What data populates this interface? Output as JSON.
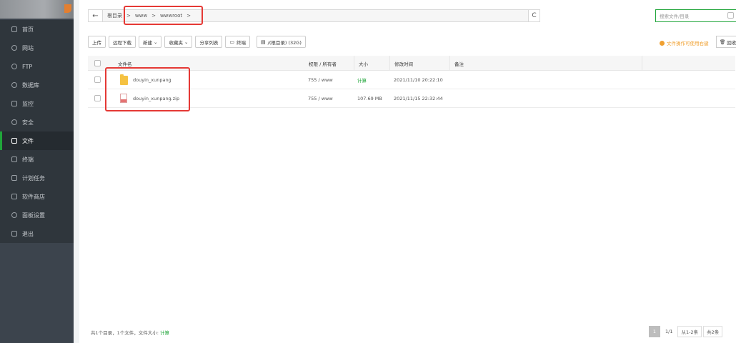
{
  "sidebar": {
    "items": [
      {
        "label": "首页",
        "icon": "home-icon",
        "active": false
      },
      {
        "label": "网站",
        "icon": "globe-icon",
        "active": false
      },
      {
        "label": "FTP",
        "icon": "ftp-icon",
        "active": false
      },
      {
        "label": "数据库",
        "icon": "database-icon",
        "active": false
      },
      {
        "label": "监控",
        "icon": "monitor-icon",
        "active": false
      },
      {
        "label": "安全",
        "icon": "shield-icon",
        "active": false
      },
      {
        "label": "文件",
        "icon": "folder-icon",
        "active": true
      },
      {
        "label": "终端",
        "icon": "terminal-icon",
        "active": false
      },
      {
        "label": "计划任务",
        "icon": "calendar-icon",
        "active": false
      },
      {
        "label": "软件商店",
        "icon": "apps-icon",
        "active": false
      },
      {
        "label": "面板设置",
        "icon": "gear-icon",
        "active": false
      },
      {
        "label": "退出",
        "icon": "logout-icon",
        "active": false
      }
    ]
  },
  "path": {
    "back_icon": "←",
    "crumbs": [
      "根目录",
      "www",
      "wwwroot"
    ],
    "separator": ">",
    "refresh_icon": "C"
  },
  "search": {
    "placeholder": "搜索文件/目录"
  },
  "toolbar": {
    "upload": "上传",
    "remote_download": "远程下载",
    "new": "新建",
    "favorites": "收藏夹",
    "share_list": "分享列表",
    "terminal": "终端",
    "drive": "/(根目录) (32G)",
    "notice": "文件操作可使用右键",
    "recycle": "回收站"
  },
  "table": {
    "headers": {
      "name": "文件名",
      "perm": "权限 / 所有者",
      "size": "大小",
      "mtime": "修改时间",
      "note": "备注"
    },
    "rows": [
      {
        "name": "douyin_xunpang",
        "type": "folder",
        "perm": "755 / www",
        "size": "计算",
        "mtime": "2021/11/10 20:22:10",
        "note": ""
      },
      {
        "name": "douyin_xunpang.zip",
        "type": "zip",
        "perm": "755 / www",
        "size": "107.69 MB",
        "mtime": "2021/11/15 22:32:44",
        "note": ""
      }
    ]
  },
  "footer": {
    "summary": "共1个目录，1个文件，文件大小:",
    "calc": "计算",
    "pager": {
      "current": "1",
      "pages": "1/1",
      "range": "从1-2条",
      "total": "共2条"
    }
  },
  "colors": {
    "accent": "#20a53a",
    "sidebar_bg": "#3c444d",
    "highlight_box": "#e53935"
  }
}
